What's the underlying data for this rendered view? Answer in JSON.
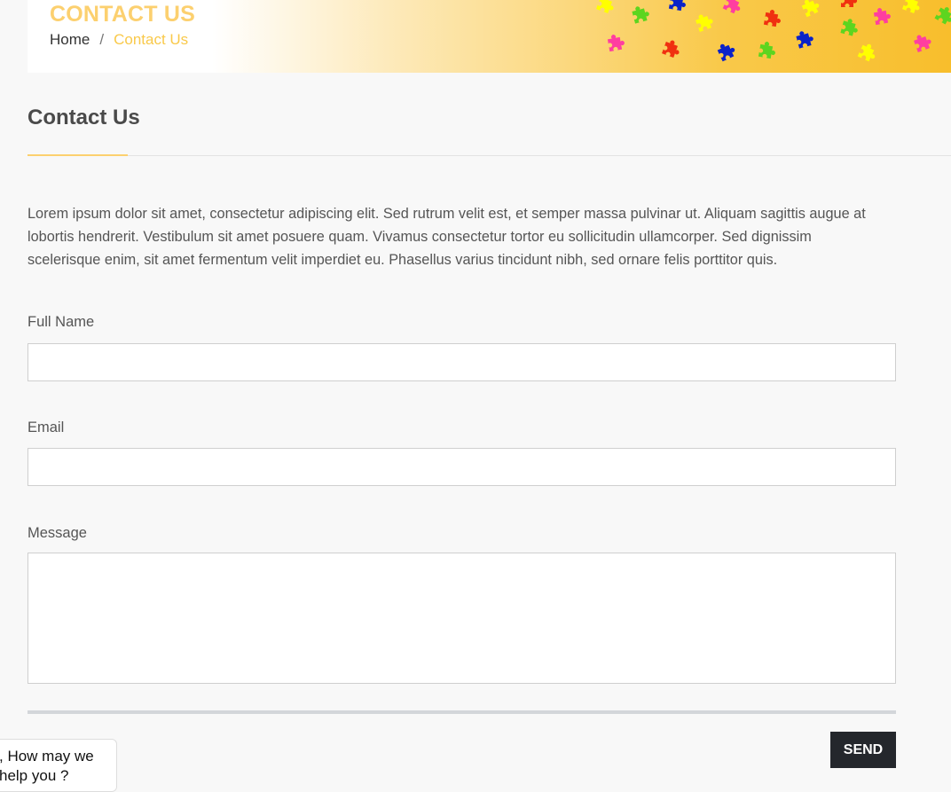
{
  "banner": {
    "title": "CONTACT US",
    "breadcrumb": {
      "home": "Home",
      "separator": "/",
      "current": "Contact Us"
    }
  },
  "main": {
    "heading": "Contact Us",
    "intro": "Lorem ipsum dolor sit amet, consectetur adipiscing elit. Sed rutrum velit est, et semper massa pulvinar ut. Aliquam sagittis augue at lobortis hendrerit. Vestibulum sit amet posuere quam. Vivamus consectetur tortor eu sollicitudin ullamcorper. Sed dignissim scelerisque enim, sit amet fermentum velit imperdiet eu. Phasellus varius tincidunt nibh, sed ornare felis porttitor quis."
  },
  "form": {
    "full_name": {
      "label": "Full Name",
      "value": ""
    },
    "email": {
      "label": "Email",
      "value": ""
    },
    "message": {
      "label": "Message",
      "value": ""
    },
    "send_label": "SEND"
  },
  "chat": {
    "line1": ", How may we",
    "line2": "help you ?"
  },
  "colors": {
    "accent": "#fcd06f",
    "banner_gold": "#f8be2c",
    "button_dark": "#24272c",
    "puzzle_pieces": [
      "#ffff00",
      "#5dd51f",
      "#0a22c8",
      "#ff3ea0",
      "#f03010"
    ]
  }
}
